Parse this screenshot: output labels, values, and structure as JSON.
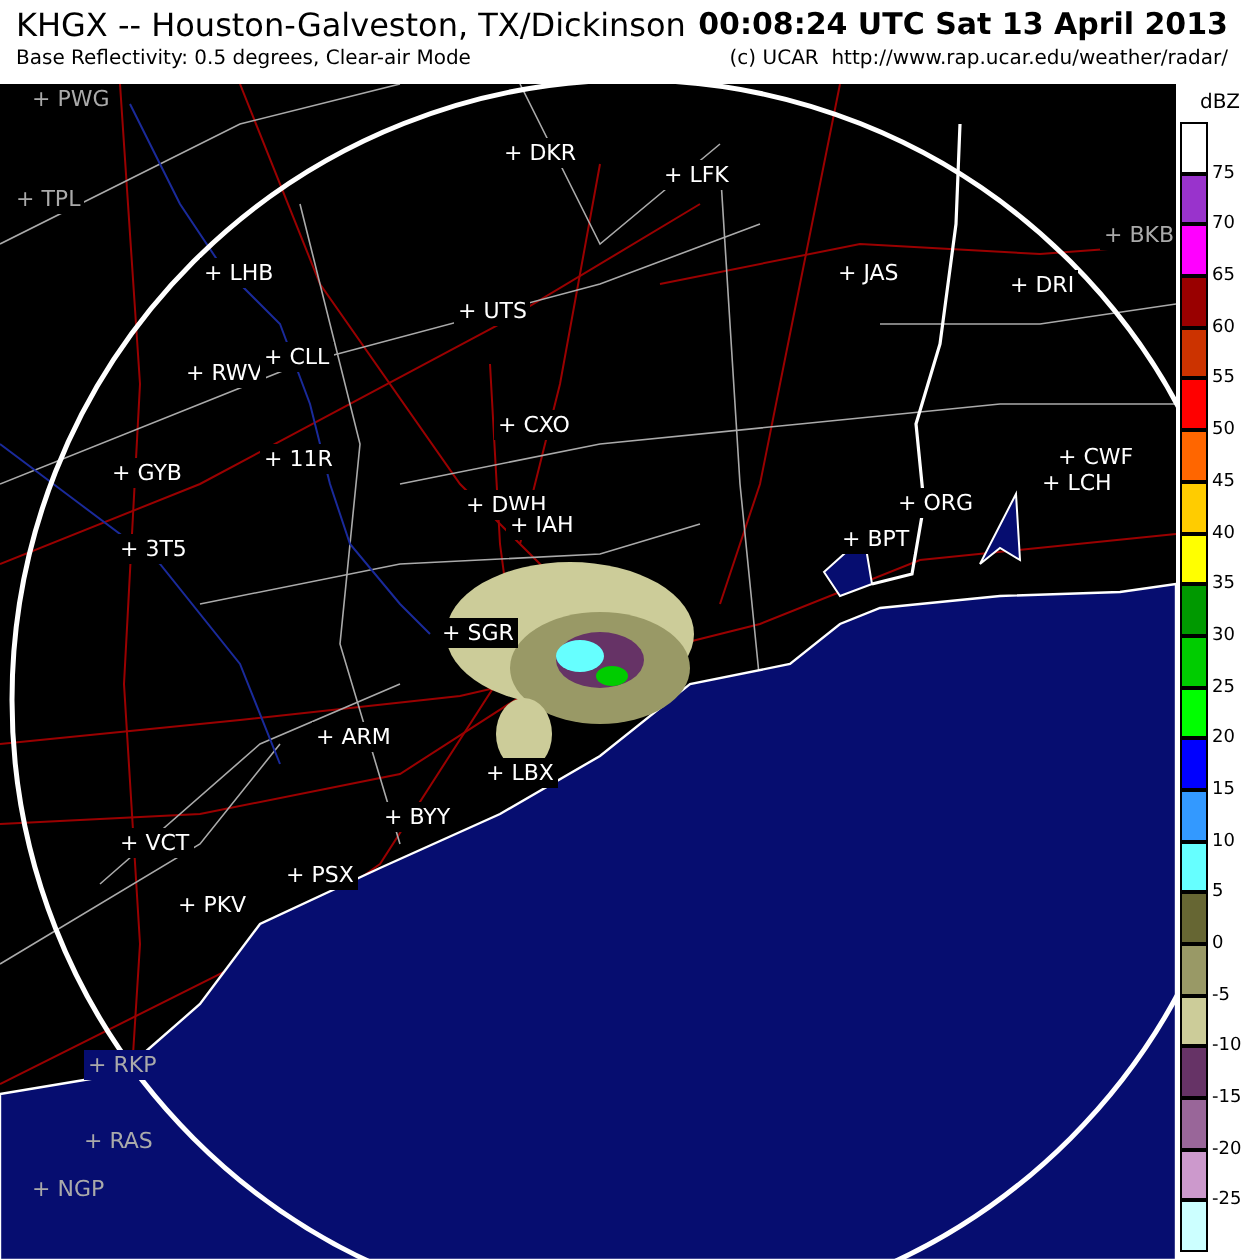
{
  "header": {
    "station": "KHGX -- Houston-Galveston, TX/Dickinson",
    "time": "00:08:24 UTC Sat 13 April 2013",
    "product": "Base Reflectivity: 0.5 degrees, Clear-air Mode",
    "credit": "(c) UCAR  http://www.rap.ucar.edu/weather/radar/"
  },
  "map": {
    "sites": [
      {
        "label": "+ PWG",
        "kind": "outside"
      },
      {
        "label": "+ TPL",
        "kind": "outside"
      },
      {
        "label": "+ DKR",
        "kind": "inside"
      },
      {
        "label": "+ LFK",
        "kind": "inside"
      },
      {
        "label": "+ LHB",
        "kind": "inside"
      },
      {
        "label": "+ UTS",
        "kind": "inside"
      },
      {
        "label": "+ JAS",
        "kind": "inside"
      },
      {
        "label": "+ DRI",
        "kind": "inside"
      },
      {
        "label": "+ BKB",
        "kind": "outside"
      },
      {
        "label": "+ RWV",
        "kind": "inside"
      },
      {
        "label": "+ CLL",
        "kind": "inside"
      },
      {
        "label": "+ CXO",
        "kind": "inside"
      },
      {
        "label": "+ 11R",
        "kind": "inside"
      },
      {
        "label": "+ GYB",
        "kind": "inside"
      },
      {
        "label": "+ CWF",
        "kind": "inside"
      },
      {
        "label": "+ LCH",
        "kind": "inside"
      },
      {
        "label": "+ DWH",
        "kind": "inside"
      },
      {
        "label": "+ IAH",
        "kind": "inside"
      },
      {
        "label": "+ ORG",
        "kind": "inside"
      },
      {
        "label": "+ BPT",
        "kind": "inside"
      },
      {
        "label": "+ 3T5",
        "kind": "inside"
      },
      {
        "label": "+ SGR",
        "kind": "inside"
      },
      {
        "label": "+ ARM",
        "kind": "inside"
      },
      {
        "label": "+ LBX",
        "kind": "inside"
      },
      {
        "label": "+ BYY",
        "kind": "inside"
      },
      {
        "label": "+ VCT",
        "kind": "inside"
      },
      {
        "label": "+ PSX",
        "kind": "inside"
      },
      {
        "label": "+ PKV",
        "kind": "inside"
      },
      {
        "label": "+ RKP",
        "kind": "outside"
      },
      {
        "label": "+ RAS",
        "kind": "outside"
      },
      {
        "label": "+ NGP",
        "kind": "outside"
      }
    ]
  },
  "legend": {
    "unit": "dBZ",
    "bins": [
      {
        "color": "#ffffff"
      },
      {
        "color": "#9933cc",
        "label": "75"
      },
      {
        "color": "#ff00ff",
        "label": "70"
      },
      {
        "color": "#990000",
        "label": "65"
      },
      {
        "color": "#cc3300",
        "label": "60"
      },
      {
        "color": "#ff0000",
        "label": "55"
      },
      {
        "color": "#ff6600",
        "label": "50"
      },
      {
        "color": "#ffcc00",
        "label": "45"
      },
      {
        "color": "#ffff00",
        "label": "40"
      },
      {
        "color": "#009900",
        "label": "35"
      },
      {
        "color": "#00cc00",
        "label": "30"
      },
      {
        "color": "#00ff00",
        "label": "25"
      },
      {
        "color": "#0000ff",
        "label": "20"
      },
      {
        "color": "#3399ff",
        "label": "15"
      },
      {
        "color": "#66ffff",
        "label": "10"
      },
      {
        "color": "#666633",
        "label": "5"
      },
      {
        "color": "#999966",
        "label": "0"
      },
      {
        "color": "#cccc99",
        "label": "-5"
      },
      {
        "color": "#663366",
        "label": "-10"
      },
      {
        "color": "#996699",
        "label": "-15"
      },
      {
        "color": "#cc99cc",
        "label": "-20"
      },
      {
        "color": "#ccffff",
        "label": "-25"
      }
    ]
  }
}
